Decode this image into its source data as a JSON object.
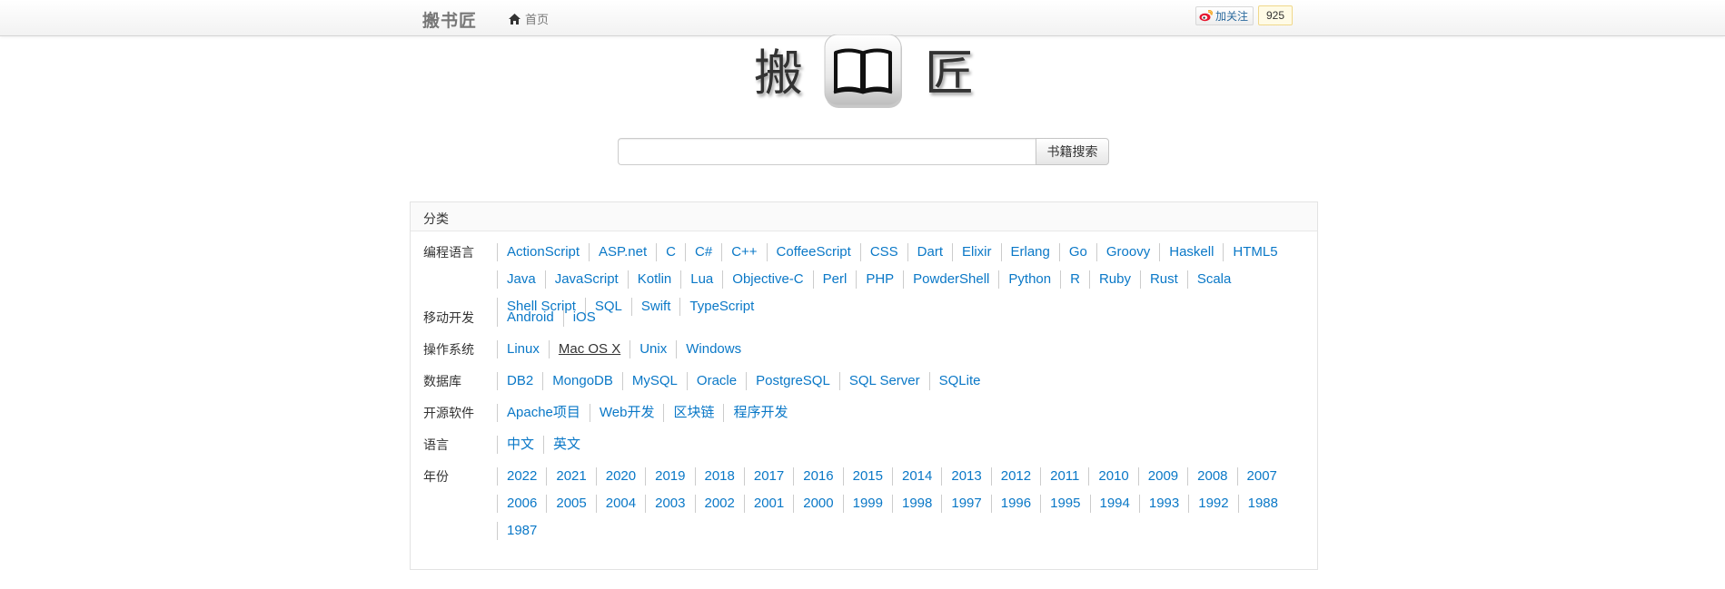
{
  "navbar": {
    "brand": "搬书匠",
    "home_label": "首页",
    "weibo_follow_label": "加关注",
    "weibo_follow_count": "925"
  },
  "logo": {
    "char_first": "搬",
    "char_last": "匠"
  },
  "search": {
    "input_value": "",
    "button_label": "书籍搜索"
  },
  "panel": {
    "title": "分类",
    "categories": [
      {
        "label": "编程语言",
        "items": [
          "ActionScript",
          "ASP.net",
          "C",
          "C#",
          "C++",
          "CoffeeScript",
          "CSS",
          "Dart",
          "Elixir",
          "Erlang",
          "Go",
          "Groovy",
          "Haskell",
          "HTML5",
          "Java",
          "JavaScript",
          "Kotlin",
          "Lua",
          "Objective-C",
          "Perl",
          "PHP",
          "PowderShell",
          "Python",
          "R",
          "Ruby",
          "Rust",
          "Scala",
          "Shell Script",
          "SQL",
          "Swift",
          "TypeScript"
        ]
      },
      {
        "label": "移动开发",
        "items": [
          "Android",
          "iOS"
        ]
      },
      {
        "label": "操作系统",
        "items": [
          "Linux",
          "Mac OS X",
          "Unix",
          "Windows"
        ],
        "active": "Mac OS X"
      },
      {
        "label": "数据库",
        "items": [
          "DB2",
          "MongoDB",
          "MySQL",
          "Oracle",
          "PostgreSQL",
          "SQL Server",
          "SQLite"
        ]
      },
      {
        "label": "开源软件",
        "items": [
          "Apache项目",
          "Web开发",
          "区块链",
          "程序开发"
        ]
      },
      {
        "label": "语言",
        "items": [
          "中文",
          "英文"
        ]
      },
      {
        "label": "年份",
        "items": [
          "2022",
          "2021",
          "2020",
          "2019",
          "2018",
          "2017",
          "2016",
          "2015",
          "2014",
          "2013",
          "2012",
          "2011",
          "2010",
          "2009",
          "2008",
          "2007",
          "2006",
          "2005",
          "2004",
          "2003",
          "2002",
          "2001",
          "2000",
          "1999",
          "1998",
          "1997",
          "1996",
          "1995",
          "1994",
          "1993",
          "1992",
          "1988",
          "1987"
        ]
      }
    ]
  },
  "colors": {
    "link": "#0a78c7",
    "text": "#333333",
    "navbar_text": "#777777"
  },
  "icons": {
    "home": "home-icon",
    "weibo": "weibo-icon",
    "logo": "open-book-icon"
  }
}
